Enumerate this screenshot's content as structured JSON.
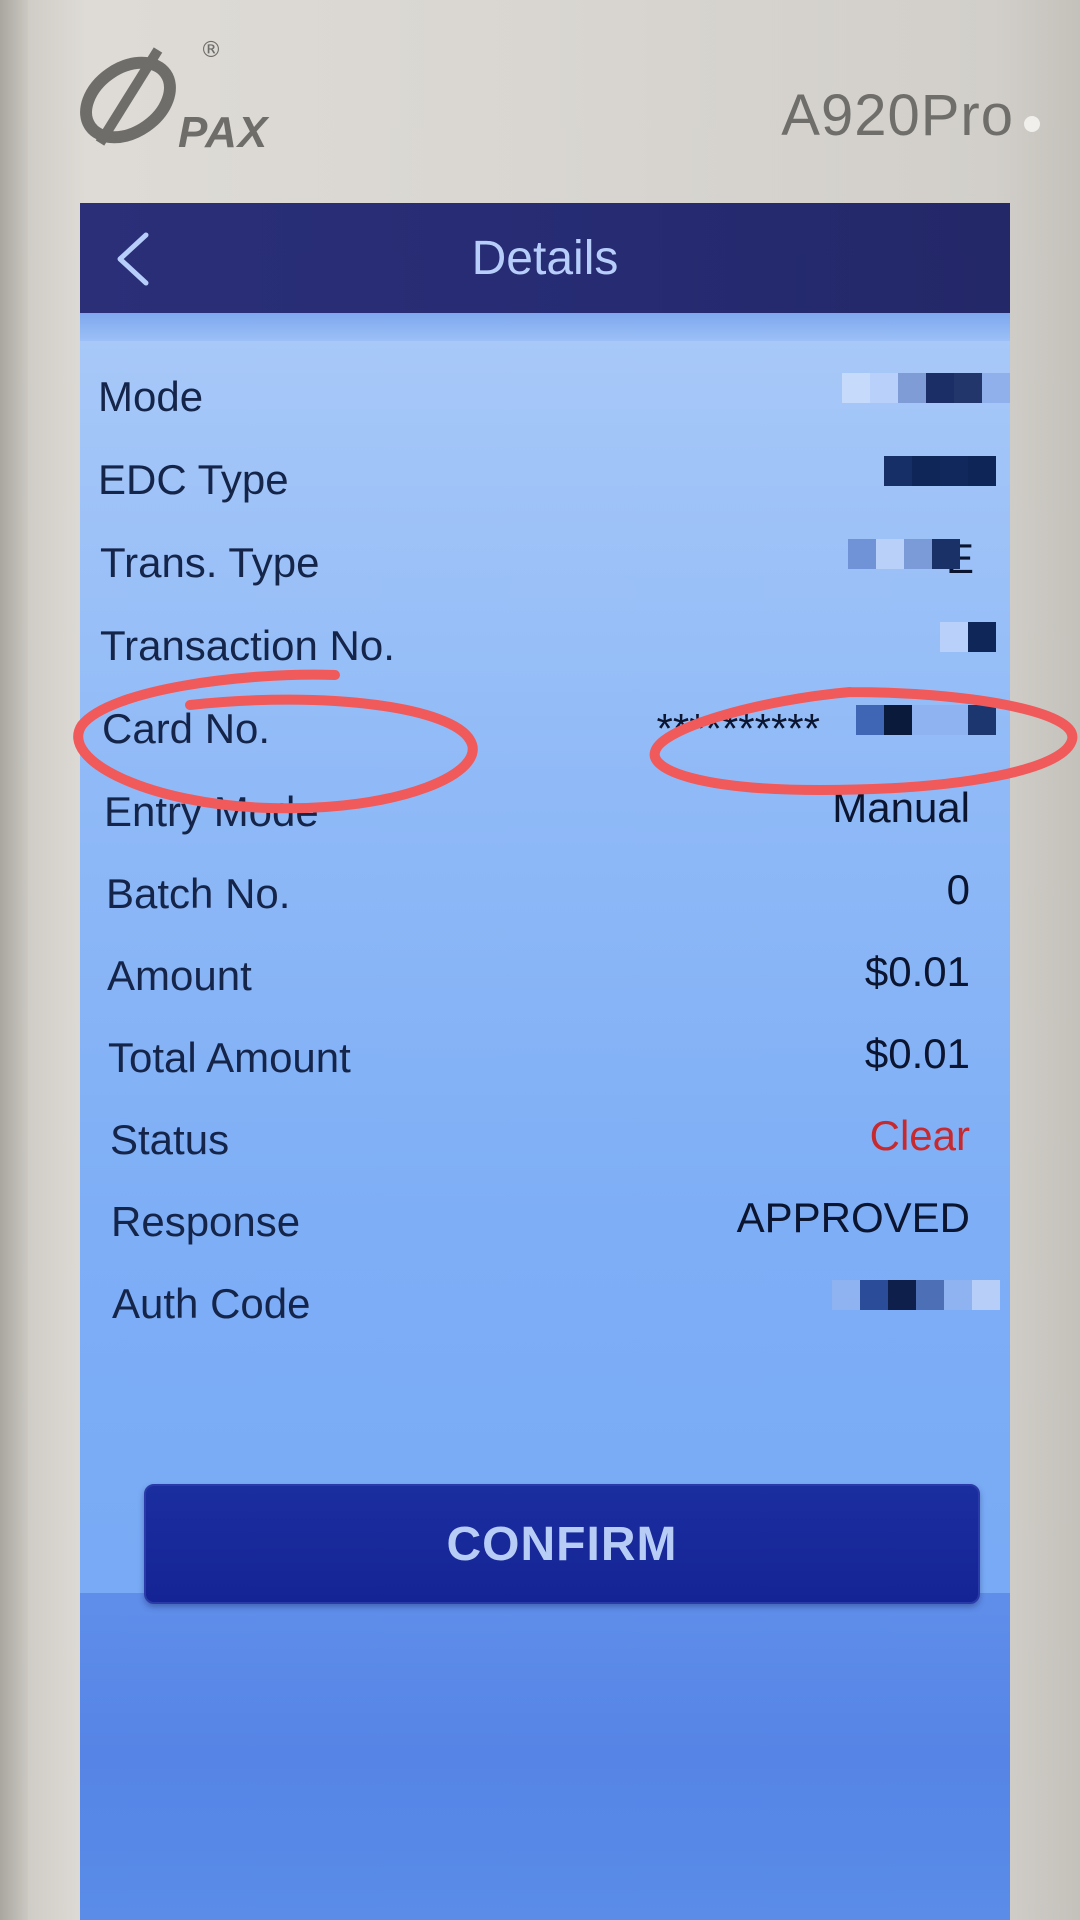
{
  "device": {
    "brand": "PAX",
    "registered_mark": "®",
    "model": "A920Pro"
  },
  "header": {
    "title": "Details",
    "back_icon": "chevron-left-icon"
  },
  "details": [
    {
      "label": "Mode",
      "value": ""
    },
    {
      "label": "EDC Type",
      "value": ""
    },
    {
      "label": "Trans. Type",
      "value": "E"
    },
    {
      "label": "Transaction No.",
      "value": ""
    },
    {
      "label": "Card No.",
      "value": "**********"
    },
    {
      "label": "Entry Mode",
      "value": "Manual"
    },
    {
      "label": "Batch No.",
      "value": "0"
    },
    {
      "label": "Amount",
      "value": "$0.01"
    },
    {
      "label": "Total Amount",
      "value": "$0.01"
    },
    {
      "label": "Status",
      "value": "Clear"
    },
    {
      "label": "Response",
      "value": "APPROVED"
    },
    {
      "label": "Auth Code",
      "value": ""
    }
  ],
  "confirm_button": {
    "label": "CONFIRM"
  },
  "colors": {
    "header_bg": "#262b72",
    "header_text": "#b7cdfa",
    "status_text": "#c62a2e",
    "confirm_bg": "#152494",
    "annotation": "#f05a5a"
  }
}
